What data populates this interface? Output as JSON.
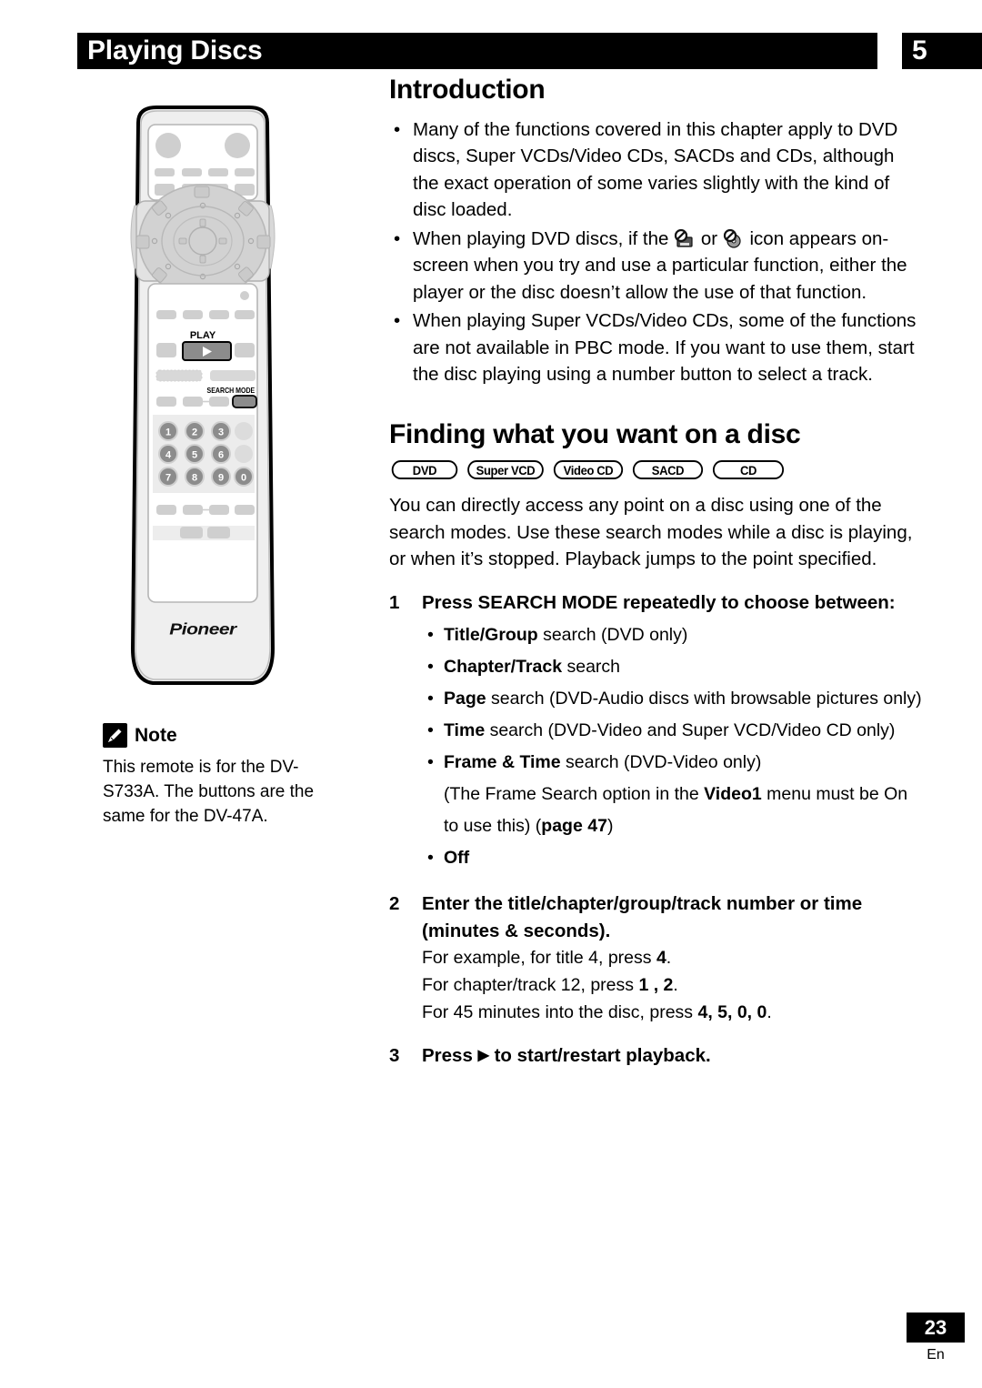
{
  "header": {
    "title": "Playing Discs",
    "chapter_number": "5"
  },
  "main": {
    "intro_heading": "Introduction",
    "intro_bullets": [
      {
        "id": "bullet-functions",
        "text": "Many of the functions covered in this chapter apply to DVD discs, Super VCDs/Video CDs, SACDs and CDs, although the exact operation of some varies slightly with the kind of disc loaded."
      },
      {
        "id": "bullet-icons",
        "text_before": "When playing DVD discs, if the",
        "icon_1": "no-tv-icon",
        "text_middle": "or",
        "icon_2": "no-disc-icon",
        "text_after": "icon appears on-screen when you try and use a particular function, either the player or the disc doesn’t allow the use of that function."
      },
      {
        "id": "bullet-pbc",
        "text": "When playing Super VCDs/Video CDs, some of the functions are not available in PBC mode. If you want to use them, start the disc playing using a number button to select a track."
      }
    ],
    "finding_heading": "Finding what you want on a disc",
    "disc_badges": [
      "DVD",
      "Super VCD",
      "Video CD",
      "SACD",
      "CD"
    ],
    "finding_paragraph": "You can directly access any point on a disc using one of the search modes. Use these search modes while a disc is playing, or when it’s stopped. Playback jumps to the point specified.",
    "steps": [
      {
        "number": "1",
        "title": "Press SEARCH MODE repeatedly to choose between:",
        "sub_bullets": [
          {
            "bold": "Title/Group",
            "rest": " search (DVD only)"
          },
          {
            "bold": "Chapter/Track",
            "rest": " search"
          },
          {
            "bold": "Page",
            "rest": " search (DVD-Audio discs with browsable pictures only)"
          },
          {
            "bold": "Time",
            "rest": " search (DVD-Video and Super VCD/Video CD only)"
          },
          {
            "bold": "Frame & Time",
            "rest": " search (DVD-Video only)"
          }
        ],
        "paren_note_pre": "(The Frame Search option in the ",
        "paren_note_bold": "Video1",
        "paren_note_mid": " menu must be On to use this) (",
        "paren_note_link_bold": "page",
        "paren_note_link_num": "47",
        "paren_note_post": ")",
        "final_bullet": "Off"
      },
      {
        "number": "2",
        "title": "Enter the title/chapter/group/track number or time (minutes & seconds).",
        "details": [
          {
            "pre": "For example, for title 4, press ",
            "bold": "4",
            "post": "."
          },
          {
            "pre": "For chapter/track 12, press ",
            "bold": "1 , 2",
            "post": "."
          },
          {
            "pre": "For 45 minutes into the disc, press ",
            "bold": "4, 5, 0, 0",
            "post": "."
          }
        ]
      },
      {
        "number": "3",
        "title_pre": "Press ",
        "title_glyph": "▶",
        "title_post": " to start/restart playback."
      }
    ]
  },
  "note": {
    "icon": "pencil-icon",
    "label": "Note",
    "text": "This remote is for the DV-S733A. The buttons are the same for the DV-47A."
  },
  "remote": {
    "name": "pioneer-remote-control",
    "brand": "Pioneer",
    "play_label": "PLAY",
    "search_mode_label": "SEARCH MODE",
    "play_glyph": "▶",
    "keypad": [
      "1",
      "2",
      "3",
      "4",
      "5",
      "6",
      "7",
      "8",
      "9",
      "0"
    ]
  },
  "footer": {
    "page_number": "23",
    "language": "En"
  },
  "colors": {
    "ink": "#000000",
    "paper": "#ffffff",
    "remote_body": "#efefef",
    "button_gray": "#cfcfcf",
    "dark_button": "#8a8a8a",
    "keypad_bg": "#ececec"
  }
}
